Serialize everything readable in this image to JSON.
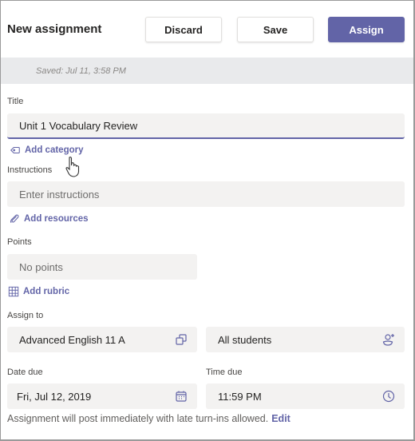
{
  "header": {
    "title": "New assignment",
    "discard_label": "Discard",
    "save_label": "Save",
    "assign_label": "Assign"
  },
  "status": {
    "saved_text": "Saved: Jul 11, 3:58 PM"
  },
  "form": {
    "title_label": "Title",
    "title_value": "Unit 1 Vocabulary Review",
    "add_category_label": "Add category",
    "instructions_label": "Instructions",
    "instructions_placeholder": "Enter instructions",
    "add_resources_label": "Add resources",
    "points_label": "Points",
    "points_value": "No points",
    "add_rubric_label": "Add rubric",
    "assign_to_label": "Assign to",
    "class_value": "Advanced English 11 A",
    "students_value": "All students",
    "date_due_label": "Date due",
    "date_due_value": "Fri, Jul 12, 2019",
    "time_due_label": "Time due",
    "time_due_value": "11:59 PM",
    "note_text": "Assignment will post immediately with late turn-ins allowed.",
    "edit_label": "Edit"
  },
  "colors": {
    "accent": "#6264a7",
    "field_bg": "#f3f2f1",
    "saved_bar": "#e9eaec"
  }
}
